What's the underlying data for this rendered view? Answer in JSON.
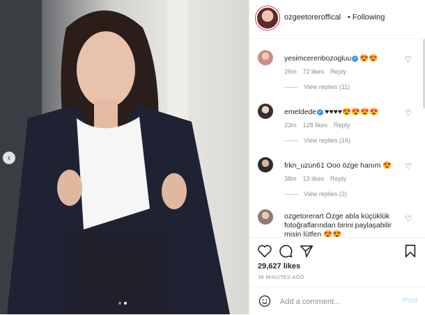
{
  "header": {
    "username": "ozgeetoreroffical",
    "follow_status": "• Following"
  },
  "comments": [
    {
      "user": "yesimcerenbozogluu",
      "verified": true,
      "text": "",
      "emoji": "😍😍",
      "time": "26m",
      "likes": "72 likes",
      "reply": "Reply",
      "view_replies": "View replies (11)"
    },
    {
      "user": "emeldede",
      "verified": true,
      "text": "",
      "emoji": "♥♥♥♥😍😍😍😍",
      "time": "23m",
      "likes": "128 likes",
      "reply": "Reply",
      "view_replies": "View replies (16)"
    },
    {
      "user": "frkn_uzun61",
      "verified": false,
      "text": "Ooo özge hanım",
      "emoji": "😍",
      "time": "38m",
      "likes": "13 likes",
      "reply": "Reply",
      "view_replies": "View replies (2)"
    },
    {
      "user": "ozgetorerart",
      "verified": false,
      "text": "Özge abla küçüklük fotoğraflarından birini paylaşabilir misin lütfen",
      "emoji": "😍😍",
      "time": "",
      "likes": "",
      "reply": "",
      "view_replies": ""
    }
  ],
  "post": {
    "likes": "29,627 likes",
    "time": "38 MINUTES AGO"
  },
  "add_comment": {
    "placeholder": "Add a comment...",
    "post_label": "Post"
  },
  "icons": {
    "like": "heart-icon",
    "comment": "comment-icon",
    "share": "share-icon",
    "save": "bookmark-icon",
    "emoji": "smile-icon",
    "prev": "chevron-left-icon"
  },
  "colors": {
    "accent": "#3897f0",
    "post_disabled": "#b3dbff",
    "muted": "#8e8e8e"
  }
}
